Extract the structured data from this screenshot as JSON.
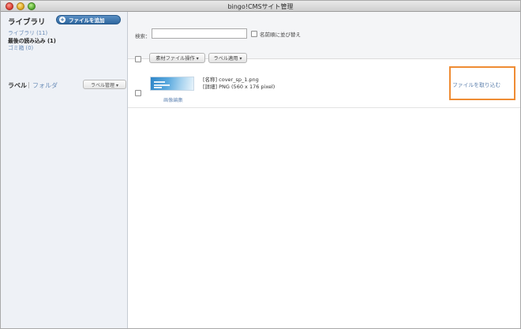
{
  "window": {
    "title": "bingo!CMSサイト管理"
  },
  "sidebar": {
    "title": "ライブラリ",
    "add_button": "ファイルを追加",
    "items": [
      {
        "label": "ライブラリ (11)"
      },
      {
        "label": "最後の読み込み (1)"
      },
      {
        "label": "ゴミ箱 (0)"
      }
    ],
    "label_tab": "ラベル",
    "separator": "|",
    "folder_tab": "フォルダ",
    "label_manage_button": "ラベル管理 ▾"
  },
  "toolbar": {
    "search_label": "検索：",
    "search_value": "",
    "sort_label": "名前順に並び替え",
    "file_ops_button": "素材ファイル操作 ▾",
    "apply_label_button": "ラベル適用 ▾"
  },
  "files": [
    {
      "name_line": "[名称]  cover_sp_1.png",
      "detail_line": "[詳細]  PNG  (560 x 176 pixel)",
      "edit_link": "画像編集",
      "import_link": "ファイルを取り込む"
    }
  ],
  "colors": {
    "accent_button": "#2e679f",
    "link": "#6b8db8",
    "highlight_border": "#ef8c33",
    "sidebar_bg": "#eef1f6"
  },
  "icons": {
    "add_button_icon": "plus-circle-icon",
    "window_controls": [
      "close-icon",
      "minimize-icon",
      "zoom-icon"
    ]
  }
}
